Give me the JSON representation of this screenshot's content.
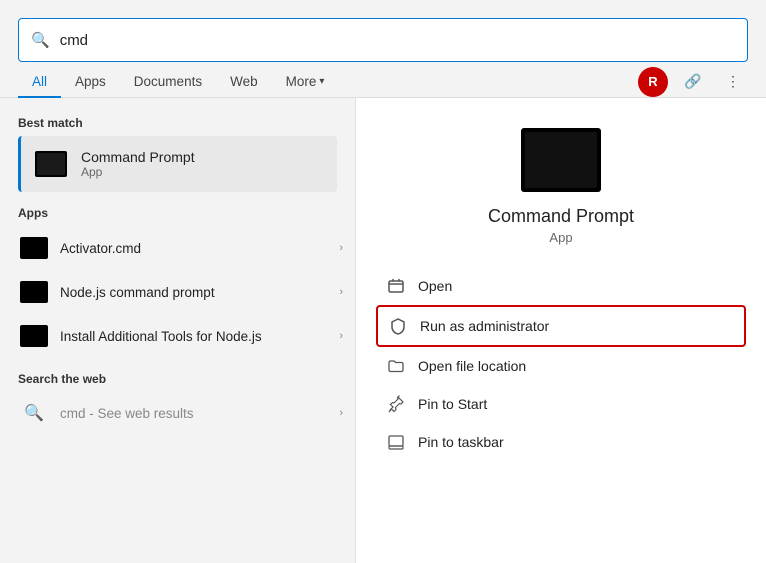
{
  "search": {
    "query": "cmd",
    "placeholder": ""
  },
  "tabs": [
    {
      "id": "all",
      "label": "All",
      "active": true
    },
    {
      "id": "apps",
      "label": "Apps",
      "active": false
    },
    {
      "id": "documents",
      "label": "Documents",
      "active": false
    },
    {
      "id": "web",
      "label": "Web",
      "active": false
    },
    {
      "id": "more",
      "label": "More",
      "active": false
    }
  ],
  "user_avatar": "R",
  "left_panel": {
    "best_match_label": "Best match",
    "best_match": {
      "name": "Command Prompt",
      "type": "App"
    },
    "apps_label": "Apps",
    "apps": [
      {
        "name": "Activator.cmd"
      },
      {
        "name": "Node.js command prompt"
      },
      {
        "name": "Install Additional Tools for Node.js"
      }
    ],
    "web_label": "Search the web",
    "web": [
      {
        "bold": "cmd",
        "suffix": " - See web results"
      }
    ]
  },
  "right_panel": {
    "name": "Command Prompt",
    "type": "App",
    "actions": [
      {
        "id": "open",
        "label": "Open",
        "highlighted": false
      },
      {
        "id": "run-as-admin",
        "label": "Run as administrator",
        "highlighted": true
      },
      {
        "id": "open-file-location",
        "label": "Open file location",
        "highlighted": false
      },
      {
        "id": "pin-to-start",
        "label": "Pin to Start",
        "highlighted": false
      },
      {
        "id": "pin-to-taskbar",
        "label": "Pin to taskbar",
        "highlighted": false
      }
    ]
  }
}
